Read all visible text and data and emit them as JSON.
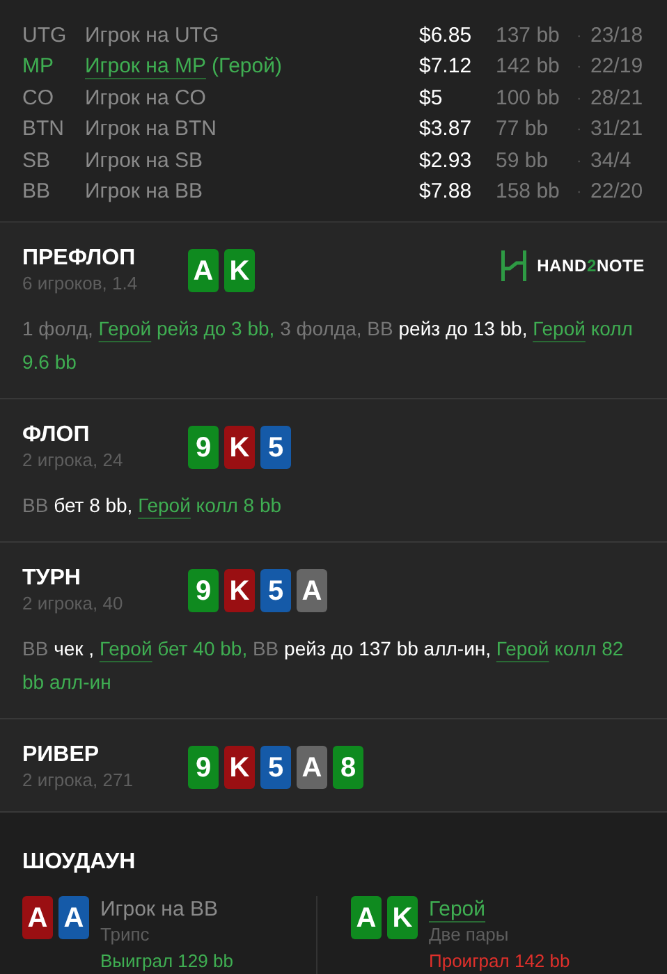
{
  "players": [
    {
      "position": "UTG",
      "name": "Игрок на UTG",
      "hero": false,
      "stack": "$6.85",
      "bb": "137 bb",
      "sep": "·",
      "stats": "23/18"
    },
    {
      "position": "MP",
      "name": "Игрок на MP",
      "suffix": "(Герой)",
      "hero": true,
      "stack": "$7.12",
      "bb": "142 bb",
      "sep": "·",
      "stats": "22/19"
    },
    {
      "position": "CO",
      "name": "Игрок на CO",
      "hero": false,
      "stack": "$5",
      "bb": "100 bb",
      "sep": "·",
      "stats": "28/21"
    },
    {
      "position": "BTN",
      "name": "Игрок на BTN",
      "hero": false,
      "stack": "$3.87",
      "bb": "77 bb",
      "sep": "·",
      "stats": "31/21"
    },
    {
      "position": "SB",
      "name": "Игрок на SB",
      "hero": false,
      "stack": "$2.93",
      "bb": "59 bb",
      "sep": "·",
      "stats": "34/4"
    },
    {
      "position": "BB",
      "name": "Игрок на BB",
      "hero": false,
      "stack": "$7.88",
      "bb": "158 bb",
      "sep": "·",
      "stats": "22/20"
    }
  ],
  "logo": [
    {
      "kind": "plain",
      "text": "HAND"
    },
    {
      "kind": "accent",
      "text": "2"
    },
    {
      "kind": "plain",
      "text": "NOTE"
    }
  ],
  "streets": [
    {
      "title": "ПРЕФЛОП",
      "subtitle": "6 игроков, 1.4",
      "cards": [
        {
          "rank": "A",
          "color": "#0f8a1f"
        },
        {
          "rank": "K",
          "color": "#0f8a1f"
        }
      ],
      "logo": true,
      "actions": [
        {
          "kind": "other",
          "text": "1 фолд, "
        },
        {
          "kind": "hero_name",
          "text": "Герой"
        },
        {
          "kind": "hero",
          "text": " рейз до 3 bb, "
        },
        {
          "kind": "other",
          "text": "3 фолда, BB "
        },
        {
          "kind": "action",
          "text": "рейз до 13 bb, "
        },
        {
          "kind": "hero_name",
          "text": "Герой"
        },
        {
          "kind": "hero",
          "text": " колл 9.6 bb"
        }
      ]
    },
    {
      "title": "ФЛОП",
      "subtitle": "2 игрока, 24",
      "cards": [
        {
          "rank": "9",
          "color": "#0f8a1f"
        },
        {
          "rank": "K",
          "color": "#9a0f12"
        },
        {
          "rank": "5",
          "color": "#155aa8"
        }
      ],
      "logo": false,
      "actions": [
        {
          "kind": "other",
          "text": "BB "
        },
        {
          "kind": "action",
          "text": "бет 8 bb, "
        },
        {
          "kind": "hero_name",
          "text": "Герой"
        },
        {
          "kind": "hero",
          "text": " колл 8 bb"
        }
      ]
    },
    {
      "title": "ТУРН",
      "subtitle": "2 игрока, 40",
      "cards": [
        {
          "rank": "9",
          "color": "#0f8a1f"
        },
        {
          "rank": "K",
          "color": "#9a0f12"
        },
        {
          "rank": "5",
          "color": "#155aa8"
        },
        {
          "rank": "A",
          "color": "#666666"
        }
      ],
      "logo": false,
      "actions": [
        {
          "kind": "other",
          "text": "BB "
        },
        {
          "kind": "action",
          "text": "чек , "
        },
        {
          "kind": "hero_name",
          "text": "Герой"
        },
        {
          "kind": "hero",
          "text": " бет 40 bb, "
        },
        {
          "kind": "other",
          "text": "BB "
        },
        {
          "kind": "action",
          "text": "рейз до 137 bb алл-ин, "
        },
        {
          "kind": "hero_name",
          "text": "Герой"
        },
        {
          "kind": "hero",
          "text": " колл 82 bb алл-ин"
        }
      ]
    },
    {
      "title": "РИВЕР",
      "subtitle": "2 игрока, 271",
      "cards": [
        {
          "rank": "9",
          "color": "#0f8a1f"
        },
        {
          "rank": "K",
          "color": "#9a0f12"
        },
        {
          "rank": "5",
          "color": "#155aa8"
        },
        {
          "rank": "A",
          "color": "#666666"
        },
        {
          "rank": "8",
          "color": "#0f8a1f"
        }
      ],
      "logo": false
    }
  ],
  "showdown": {
    "title": "ШОУДАУН",
    "hands": [
      {
        "cards": [
          {
            "rank": "A",
            "color": "#9a0f12"
          },
          {
            "rank": "A",
            "color": "#155aa8"
          }
        ],
        "name": "Игрок на BB",
        "hero": false,
        "hand": "Трипс",
        "result": "Выиграл 129 bb",
        "kind": "won"
      },
      {
        "cards": [
          {
            "rank": "A",
            "color": "#0f8a1f"
          },
          {
            "rank": "K",
            "color": "#0f8a1f"
          }
        ],
        "name": "Герой",
        "hero": true,
        "hand": "Две пары",
        "result": "Проиграл 142 bb",
        "kind": "lost"
      }
    ]
  }
}
